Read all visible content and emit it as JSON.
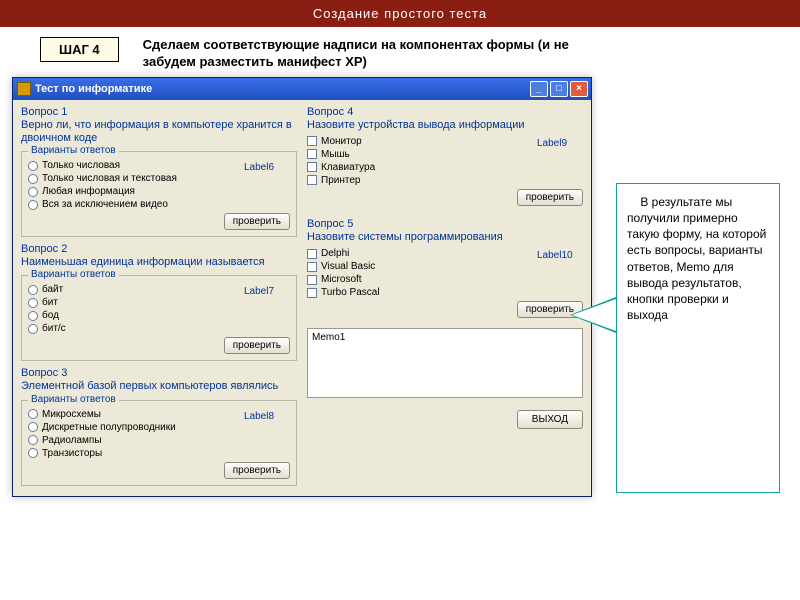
{
  "slide": {
    "title": "Создание простого теста",
    "step_label": "ШАГ 4",
    "step_text": "Сделаем соответствующие надписи на компонентах формы (и не забудем разместить манифест XP)"
  },
  "window": {
    "title": "Тест по информатике"
  },
  "groupbox_legend": "Варианты ответов",
  "check_button": "проверить",
  "exit_button": "ВЫХОД",
  "memo_text": "Memo1",
  "q1": {
    "title": "Вопрос 1",
    "text": "Верно ли, что информация в компьютере хранится в двоичном коде",
    "label": "Label6",
    "opts": [
      "Только числовая",
      "Только числовая и текстовая",
      "Любая информация",
      "Вся за исключением видео"
    ]
  },
  "q2": {
    "title": "Вопрос 2",
    "text": "Наименьшая единица информации называется",
    "label": "Label7",
    "opts": [
      "байт",
      "бит",
      "бод",
      "бит/с"
    ]
  },
  "q3": {
    "title": "Вопрос 3",
    "text": "Элементной базой первых компьютеров являлись",
    "label": "Label8",
    "opts": [
      "Микросхемы",
      "Дискретные полупроводники",
      "Радиолампы",
      "Транзисторы"
    ]
  },
  "q4": {
    "title": "Вопрос 4",
    "text": "Назовите устройства вывода информации",
    "label": "Label9",
    "opts": [
      "Монитор",
      "Мышь",
      "Клавиатура",
      "Принтер"
    ]
  },
  "q5": {
    "title": "Вопрос 5",
    "text": "Назовите системы программирования",
    "label": "Label10",
    "opts": [
      "Delphi",
      "Visual Basic",
      "Microsoft",
      "Turbo Pascal"
    ]
  },
  "callout": "    В результате мы получили примерно такую форму, на которой есть вопросы, варианты ответов, Memo для вывода результатов,  кнопки проверки и выхода"
}
